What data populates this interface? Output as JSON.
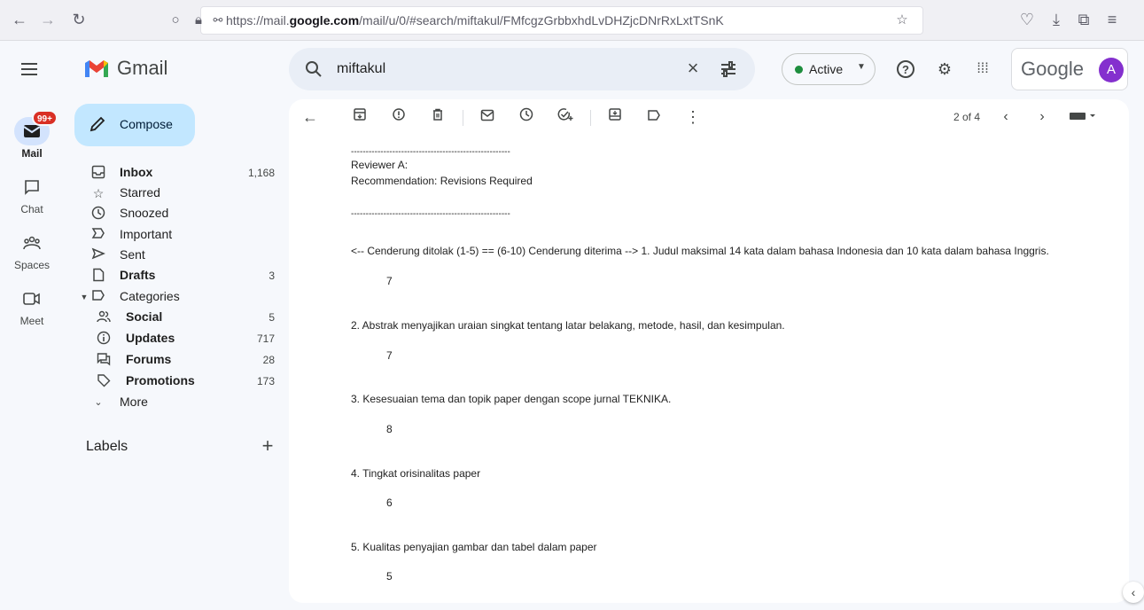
{
  "browser": {
    "url_prefix": "https://mail.",
    "url_domain": "google.com",
    "url_path": "/mail/u/0/#search/miftakul/FMfcgzGrbbxhdLvDHZjcDNrRxLxtTSnK"
  },
  "header": {
    "app_name": "Gmail",
    "search_value": "miftakul",
    "status_label": "Active",
    "google_text": "Google",
    "avatar_letter": "A"
  },
  "rail": {
    "mail_label": "Mail",
    "mail_badge": "99+",
    "chat_label": "Chat",
    "spaces_label": "Spaces",
    "meet_label": "Meet"
  },
  "compose_label": "Compose",
  "nav": {
    "inbox": {
      "label": "Inbox",
      "count": "1,168"
    },
    "starred": {
      "label": "Starred"
    },
    "snoozed": {
      "label": "Snoozed"
    },
    "important": {
      "label": "Important"
    },
    "sent": {
      "label": "Sent"
    },
    "drafts": {
      "label": "Drafts",
      "count": "3"
    },
    "categories": {
      "label": "Categories"
    },
    "social": {
      "label": "Social",
      "count": "5"
    },
    "updates": {
      "label": "Updates",
      "count": "717"
    },
    "forums": {
      "label": "Forums",
      "count": "28"
    },
    "promotions": {
      "label": "Promotions",
      "count": "173"
    },
    "more": {
      "label": "More"
    },
    "labels_header": "Labels"
  },
  "toolbar": {
    "pager": "2 of 4"
  },
  "message": {
    "divider": "------------------------------------------------------",
    "reviewer": "Reviewer A:",
    "recommendation": "Recommendation: Revisions Required",
    "scale": "<-- Cenderung ditolak (1-5) == (6-10) Cenderung diterima --> 1. Judul maksimal 14 kata dalam bahasa Indonesia dan 10 kata dalam bahasa Inggris.",
    "items": [
      {
        "score": "7"
      },
      {
        "text": "2. Abstrak menyajikan uraian singkat tentang latar belakang, metode, hasil, dan kesimpulan.",
        "score": "7"
      },
      {
        "text": "3. Kesesuaian tema dan topik paper dengan scope jurnal TEKNIKA.",
        "score": "8"
      },
      {
        "text": "4. Tingkat orisinalitas paper",
        "score": "6"
      },
      {
        "text": "5. Kualitas penyajian gambar dan tabel dalam paper",
        "score": "5"
      }
    ]
  }
}
